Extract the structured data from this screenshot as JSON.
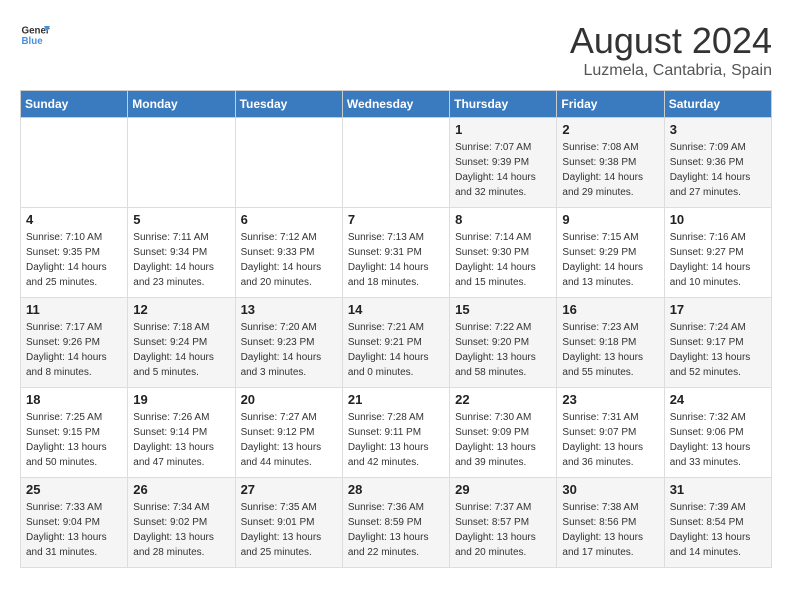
{
  "header": {
    "logo_line1": "General",
    "logo_line2": "Blue",
    "month_title": "August 2024",
    "subtitle": "Luzmela, Cantabria, Spain"
  },
  "weekdays": [
    "Sunday",
    "Monday",
    "Tuesday",
    "Wednesday",
    "Thursday",
    "Friday",
    "Saturday"
  ],
  "weeks": [
    [
      {
        "day": "",
        "info": ""
      },
      {
        "day": "",
        "info": ""
      },
      {
        "day": "",
        "info": ""
      },
      {
        "day": "",
        "info": ""
      },
      {
        "day": "1",
        "info": "Sunrise: 7:07 AM\nSunset: 9:39 PM\nDaylight: 14 hours\nand 32 minutes."
      },
      {
        "day": "2",
        "info": "Sunrise: 7:08 AM\nSunset: 9:38 PM\nDaylight: 14 hours\nand 29 minutes."
      },
      {
        "day": "3",
        "info": "Sunrise: 7:09 AM\nSunset: 9:36 PM\nDaylight: 14 hours\nand 27 minutes."
      }
    ],
    [
      {
        "day": "4",
        "info": "Sunrise: 7:10 AM\nSunset: 9:35 PM\nDaylight: 14 hours\nand 25 minutes."
      },
      {
        "day": "5",
        "info": "Sunrise: 7:11 AM\nSunset: 9:34 PM\nDaylight: 14 hours\nand 23 minutes."
      },
      {
        "day": "6",
        "info": "Sunrise: 7:12 AM\nSunset: 9:33 PM\nDaylight: 14 hours\nand 20 minutes."
      },
      {
        "day": "7",
        "info": "Sunrise: 7:13 AM\nSunset: 9:31 PM\nDaylight: 14 hours\nand 18 minutes."
      },
      {
        "day": "8",
        "info": "Sunrise: 7:14 AM\nSunset: 9:30 PM\nDaylight: 14 hours\nand 15 minutes."
      },
      {
        "day": "9",
        "info": "Sunrise: 7:15 AM\nSunset: 9:29 PM\nDaylight: 14 hours\nand 13 minutes."
      },
      {
        "day": "10",
        "info": "Sunrise: 7:16 AM\nSunset: 9:27 PM\nDaylight: 14 hours\nand 10 minutes."
      }
    ],
    [
      {
        "day": "11",
        "info": "Sunrise: 7:17 AM\nSunset: 9:26 PM\nDaylight: 14 hours\nand 8 minutes."
      },
      {
        "day": "12",
        "info": "Sunrise: 7:18 AM\nSunset: 9:24 PM\nDaylight: 14 hours\nand 5 minutes."
      },
      {
        "day": "13",
        "info": "Sunrise: 7:20 AM\nSunset: 9:23 PM\nDaylight: 14 hours\nand 3 minutes."
      },
      {
        "day": "14",
        "info": "Sunrise: 7:21 AM\nSunset: 9:21 PM\nDaylight: 14 hours\nand 0 minutes."
      },
      {
        "day": "15",
        "info": "Sunrise: 7:22 AM\nSunset: 9:20 PM\nDaylight: 13 hours\nand 58 minutes."
      },
      {
        "day": "16",
        "info": "Sunrise: 7:23 AM\nSunset: 9:18 PM\nDaylight: 13 hours\nand 55 minutes."
      },
      {
        "day": "17",
        "info": "Sunrise: 7:24 AM\nSunset: 9:17 PM\nDaylight: 13 hours\nand 52 minutes."
      }
    ],
    [
      {
        "day": "18",
        "info": "Sunrise: 7:25 AM\nSunset: 9:15 PM\nDaylight: 13 hours\nand 50 minutes."
      },
      {
        "day": "19",
        "info": "Sunrise: 7:26 AM\nSunset: 9:14 PM\nDaylight: 13 hours\nand 47 minutes."
      },
      {
        "day": "20",
        "info": "Sunrise: 7:27 AM\nSunset: 9:12 PM\nDaylight: 13 hours\nand 44 minutes."
      },
      {
        "day": "21",
        "info": "Sunrise: 7:28 AM\nSunset: 9:11 PM\nDaylight: 13 hours\nand 42 minutes."
      },
      {
        "day": "22",
        "info": "Sunrise: 7:30 AM\nSunset: 9:09 PM\nDaylight: 13 hours\nand 39 minutes."
      },
      {
        "day": "23",
        "info": "Sunrise: 7:31 AM\nSunset: 9:07 PM\nDaylight: 13 hours\nand 36 minutes."
      },
      {
        "day": "24",
        "info": "Sunrise: 7:32 AM\nSunset: 9:06 PM\nDaylight: 13 hours\nand 33 minutes."
      }
    ],
    [
      {
        "day": "25",
        "info": "Sunrise: 7:33 AM\nSunset: 9:04 PM\nDaylight: 13 hours\nand 31 minutes."
      },
      {
        "day": "26",
        "info": "Sunrise: 7:34 AM\nSunset: 9:02 PM\nDaylight: 13 hours\nand 28 minutes."
      },
      {
        "day": "27",
        "info": "Sunrise: 7:35 AM\nSunset: 9:01 PM\nDaylight: 13 hours\nand 25 minutes."
      },
      {
        "day": "28",
        "info": "Sunrise: 7:36 AM\nSunset: 8:59 PM\nDaylight: 13 hours\nand 22 minutes."
      },
      {
        "day": "29",
        "info": "Sunrise: 7:37 AM\nSunset: 8:57 PM\nDaylight: 13 hours\nand 20 minutes."
      },
      {
        "day": "30",
        "info": "Sunrise: 7:38 AM\nSunset: 8:56 PM\nDaylight: 13 hours\nand 17 minutes."
      },
      {
        "day": "31",
        "info": "Sunrise: 7:39 AM\nSunset: 8:54 PM\nDaylight: 13 hours\nand 14 minutes."
      }
    ]
  ]
}
